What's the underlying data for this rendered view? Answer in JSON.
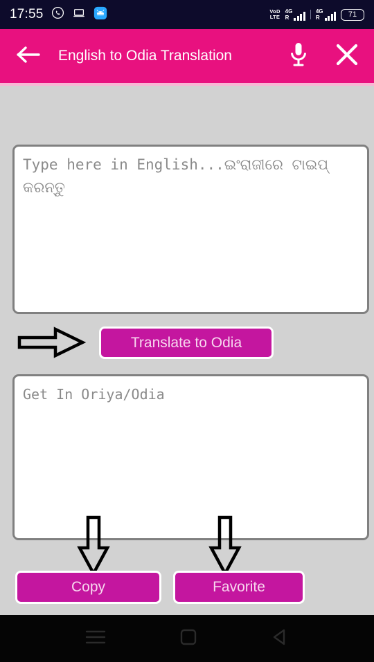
{
  "status_bar": {
    "time": "17:55",
    "icons": [
      "whatsapp-icon",
      "laptop-icon",
      "android-icon"
    ],
    "volte_line1": "VoD",
    "volte_line2": "LTE",
    "sim1_network": "4G",
    "sim1_roaming": "R",
    "sim2_network": "4G",
    "sim2_roaming": "R",
    "battery_level": "71"
  },
  "app_bar": {
    "back_icon": "back-arrow-icon",
    "title": "English to Odia Translation",
    "mic_icon": "microphone-icon",
    "close_icon": "close-icon",
    "background_color": "#e8117f"
  },
  "input_field": {
    "placeholder": "Type here in English...ଇଂରାଜୀରେ ଟାଇପ୍ କରନ୍ତୁ",
    "value": ""
  },
  "translate_button": {
    "label": "Translate to Odia"
  },
  "output_field": {
    "placeholder": "Get In Oriya/Odia",
    "value": ""
  },
  "copy_button": {
    "label": "Copy"
  },
  "favorite_button": {
    "label": "Favorite"
  },
  "annotations": [
    {
      "name": "arrow-right-to-translate",
      "direction": "right"
    },
    {
      "name": "arrow-down-to-copy",
      "direction": "down"
    },
    {
      "name": "arrow-down-to-favorite",
      "direction": "down"
    }
  ],
  "nav_bar": {
    "recents_icon": "menu-icon",
    "home_icon": "square-home-icon",
    "back_icon": "triangle-back-icon"
  },
  "theme": {
    "accent": "#e8117f",
    "button_fill": "#c4169f",
    "page_background": "#d2d2d2",
    "card_border": "#808080",
    "placeholder_text": "#8a8a8a"
  }
}
